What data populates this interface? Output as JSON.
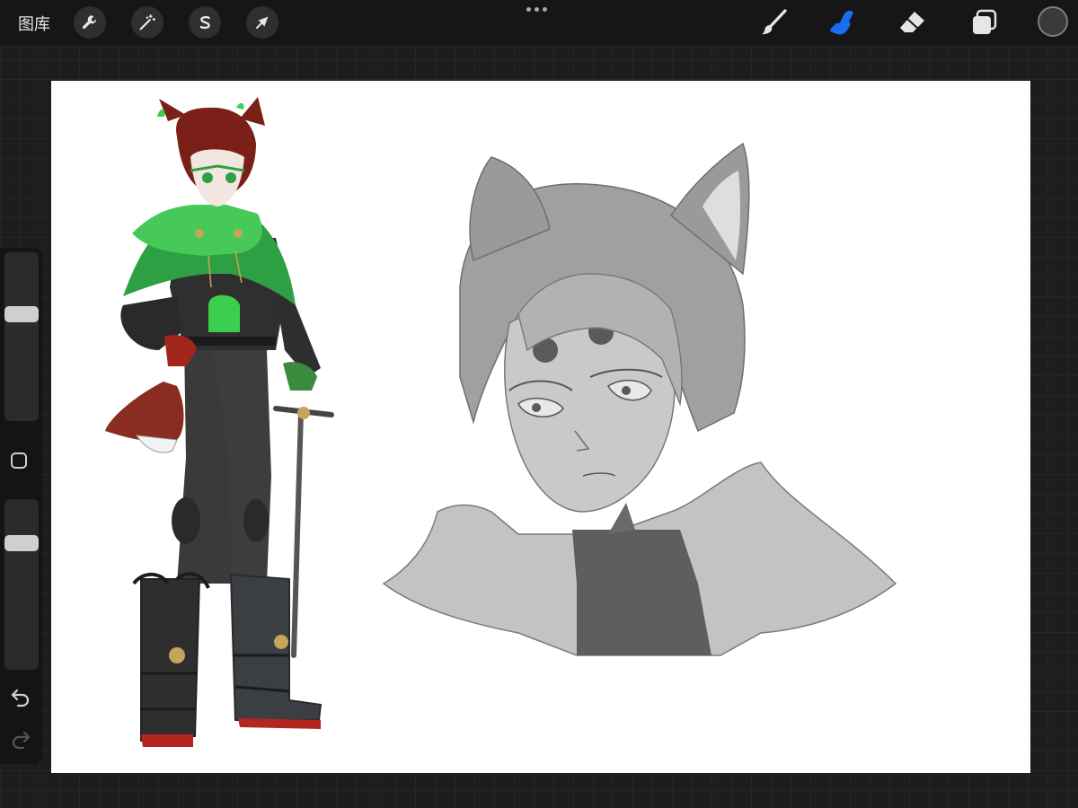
{
  "topbar": {
    "gallery_label": "图库",
    "tools_left": [
      {
        "name": "actions",
        "icon": "wrench-icon"
      },
      {
        "name": "adjustments",
        "icon": "magic-wand-icon"
      },
      {
        "name": "selection",
        "icon": "selection-s-icon"
      },
      {
        "name": "transform",
        "icon": "arrow-cursor-icon"
      }
    ],
    "tools_right": [
      {
        "name": "brush",
        "icon": "brush-icon",
        "active": false
      },
      {
        "name": "smudge",
        "icon": "smudge-finger-icon",
        "active": true
      },
      {
        "name": "eraser",
        "icon": "eraser-icon",
        "active": false
      },
      {
        "name": "layers",
        "icon": "layers-icon",
        "active": false
      }
    ],
    "current_color": "#3a3a3a",
    "active_tool_color": "#1a6cf0"
  },
  "sidebar": {
    "brush_size_level": 0.35,
    "opacity_level": 0.23,
    "modifier_icon": "square-modifier-icon",
    "undo_icon": "undo-arrow-icon",
    "redo_icon": "redo-arrow-icon"
  },
  "canvas": {
    "background": "#ffffff",
    "artwork": "character-sketch"
  }
}
